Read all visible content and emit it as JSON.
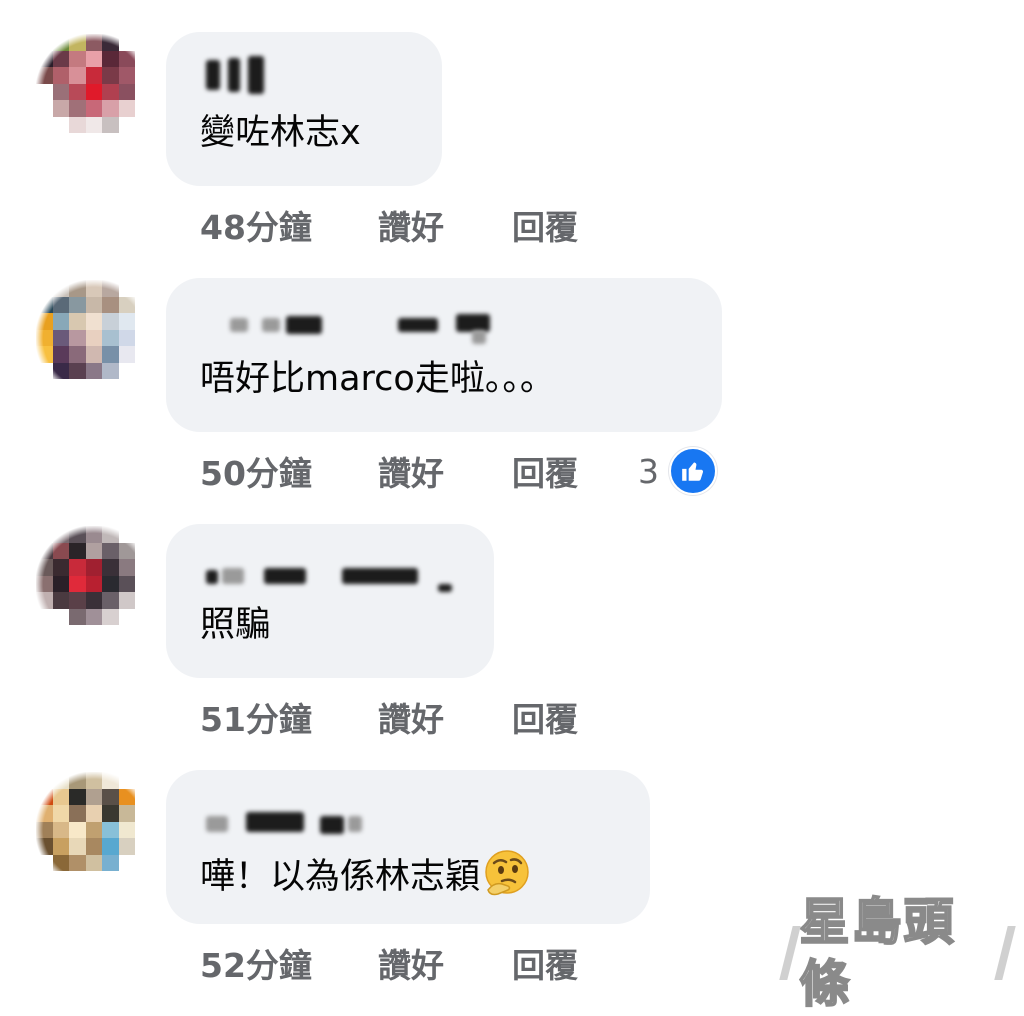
{
  "comments": [
    {
      "text": "變咗林志x",
      "time": "48分鐘",
      "like_label": "讚好",
      "reply_label": "回覆",
      "avatar_colors": [
        "#fff",
        "#6b8a3a",
        "#c2b560",
        "#8c5a62",
        "#3a2a38",
        "#fff",
        "#fff",
        "#2a1e2a",
        "#6a3a48",
        "#c47a80",
        "#e8a0a8",
        "#5a2838",
        "#8a4a5a",
        "#fff",
        "#7a4a4a",
        "#b0606a",
        "#d89098",
        "#c82a3a",
        "#7a3a48",
        "#a05868",
        "#fff",
        "#fff",
        "#9a7078",
        "#b84a58",
        "#e01a2a",
        "#b04050",
        "#8a5060",
        "#fff",
        "#fff",
        "#c8a8a8",
        "#a07078",
        "#c86878",
        "#d8a0a8",
        "#e8d0d0",
        "#fff",
        "#fff",
        "#fff",
        "#e8d8d8",
        "#f0e8e8",
        "#c8c0c0",
        "#fff",
        "#fff",
        "#fff",
        "#fff",
        "#fff",
        "#fff",
        "#fff",
        "#fff",
        "#fff"
      ]
    },
    {
      "text": "唔好比marco走啦。。。",
      "time": "50分鐘",
      "like_label": "讚好",
      "reply_label": "回覆",
      "reaction_count": "3",
      "avatar_colors": [
        "#fff",
        "#c8c0b8",
        "#a89888",
        "#d8c8b8",
        "#b8a8a0",
        "#fff",
        "#fff",
        "#2a4a5a",
        "#5a6a78",
        "#8898a0",
        "#c8b8a8",
        "#a89080",
        "#d8d0c0",
        "#fff",
        "#e8a020",
        "#88a8b8",
        "#d8c8b0",
        "#f0e0d0",
        "#c8d0d8",
        "#e0e8f0",
        "#fff",
        "#f0b030",
        "#6a5a7a",
        "#b898a0",
        "#e8d0c0",
        "#a8c0d0",
        "#d0d8e8",
        "#fff",
        "#f8c040",
        "#5a3a5a",
        "#8a6a7a",
        "#d0b8b0",
        "#7890a8",
        "#e8e8f0",
        "#fff",
        "#fff",
        "#3a2a48",
        "#5a4050",
        "#8a7888",
        "#b0b8c8",
        "#fff",
        "#fff",
        "#fff",
        "#fff",
        "#fff",
        "#fff",
        "#fff",
        "#fff",
        "#fff"
      ]
    },
    {
      "text": "照騙",
      "time": "51分鐘",
      "like_label": "讚好",
      "reply_label": "回覆",
      "avatar_colors": [
        "#fff",
        "#7a6a70",
        "#5a5058",
        "#9a8a90",
        "#c0b8b8",
        "#fff",
        "#fff",
        "#4a3a40",
        "#8a4a50",
        "#2a2428",
        "#b0a0a0",
        "#6a6068",
        "#a09898",
        "#fff",
        "#6a5a5a",
        "#3a2a30",
        "#c82a3a",
        "#a02030",
        "#3a3038",
        "#8a7a80",
        "#fff",
        "#8a7070",
        "#2a2028",
        "#e02a3a",
        "#b82030",
        "#2a2a30",
        "#5a5058",
        "#fff",
        "#c0b0b0",
        "#4a3a40",
        "#5a4048",
        "#3a3038",
        "#6a6068",
        "#d0c8c8",
        "#fff",
        "#fff",
        "#fff",
        "#7a6a70",
        "#a09098",
        "#d8d0d0",
        "#fff",
        "#fff",
        "#fff",
        "#fff",
        "#fff",
        "#fff",
        "#fff",
        "#fff",
        "#fff"
      ]
    },
    {
      "text": "嘩！以為係林志穎",
      "time": "52分鐘",
      "like_label": "讚好",
      "reply_label": "回覆",
      "avatar_colors": [
        "#fff",
        "#e8e0c8",
        "#a89878",
        "#d0c0a0",
        "#f0e8d8",
        "#fff",
        "#fff",
        "#d04a10",
        "#e8c890",
        "#2a2a28",
        "#b0a090",
        "#5a5048",
        "#e89020",
        "#fff",
        "#e0b070",
        "#f0d8a8",
        "#8a7058",
        "#e8d0b0",
        "#3a3830",
        "#c8b898",
        "#fff",
        "#a08058",
        "#d8b888",
        "#f8e8c8",
        "#c0a070",
        "#88c0d8",
        "#f0e8d0",
        "#fff",
        "#6a5030",
        "#c8a060",
        "#e8d8b8",
        "#a88860",
        "#58a8d0",
        "#d8d0c0",
        "#fff",
        "#fff",
        "#8a6838",
        "#b09068",
        "#d0c0a0",
        "#78b0d0",
        "#fff",
        "#fff",
        "#fff",
        "#fff",
        "#fff",
        "#fff",
        "#fff",
        "#fff",
        "#fff"
      ]
    }
  ],
  "watermark": "星島頭條",
  "icons": {
    "like": "thumbs-up-icon",
    "emoji": "thinking-face-emoji"
  },
  "colors": {
    "bubble": "#f0f2f5",
    "like_blue": "#1877f2",
    "meta_gray": "#65676b"
  }
}
